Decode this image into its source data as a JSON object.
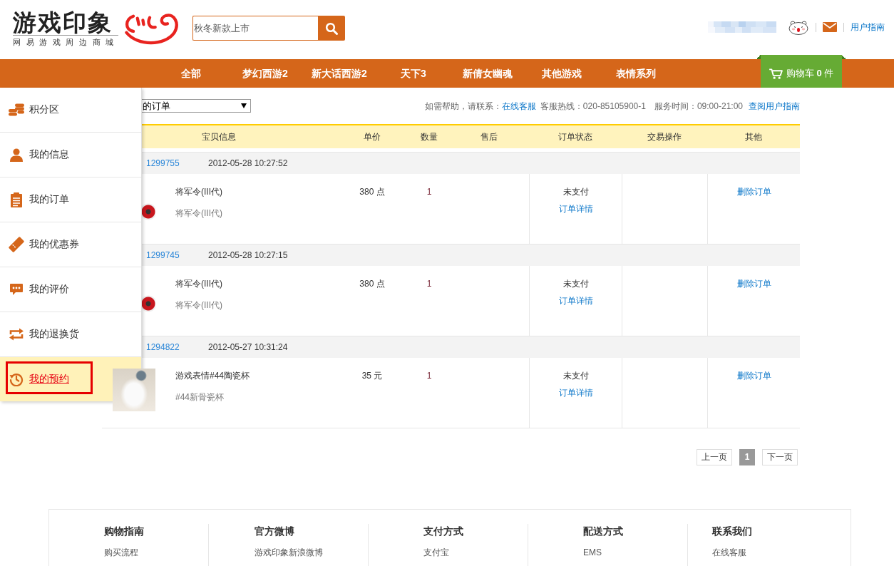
{
  "header": {
    "logo": {
      "title": "游戏印象",
      "subtitle": "网易游戏周边商城"
    },
    "search": {
      "placeholder": "秋冬新款上市"
    },
    "guide_link": "用户指南"
  },
  "nav": {
    "items": [
      "全部",
      "梦幻西游2",
      "新大话西游2",
      "天下3",
      "新倩女幽魂",
      "其他游戏",
      "表情系列"
    ],
    "cart": "购物车 **0** 件"
  },
  "sidebar": {
    "items": [
      {
        "label": "积分区",
        "selected": false,
        "highlighted": false
      },
      {
        "label": "我的信息",
        "selected": false,
        "highlighted": false
      },
      {
        "label": "我的订单",
        "selected": false,
        "highlighted": false
      },
      {
        "label": "我的优惠券",
        "selected": false,
        "highlighted": false
      },
      {
        "label": "我的评价",
        "selected": false,
        "highlighted": false
      },
      {
        "label": "我的退换货",
        "selected": false,
        "highlighted": false
      },
      {
        "label": "我的预约",
        "selected": true,
        "highlighted": true
      }
    ]
  },
  "order_filter": {
    "value": "的订单"
  },
  "help": {
    "prompt": "如需帮助，请联系：",
    "chat_link": "在线客服",
    "hotline": "客服热线：020-85105900-1",
    "hours": "服务时间：09:00-21:00",
    "guide_link": "查阅用户指南"
  },
  "table": {
    "columns": [
      "宝贝信息",
      "单价",
      "数量",
      "售后",
      "订单状态",
      "交易操作",
      "其他"
    ],
    "orders": [
      {
        "number": "1299755",
        "time": "2012-05-28 10:27:52",
        "item": {
          "name": "将军令(III代)",
          "spec": "将军令(III代)",
          "price": "380 点",
          "quantity": "1"
        },
        "status": "未支付",
        "detail_link": "订单详情",
        "action": "删除订单"
      },
      {
        "number": "1299745",
        "time": "2012-05-28 10:27:15",
        "item": {
          "name": "将军令(III代)",
          "spec": "将军令(III代)",
          "price": "380 点",
          "quantity": "1"
        },
        "status": "未支付",
        "detail_link": "订单详情",
        "action": "删除订单"
      },
      {
        "number": "1294822",
        "time": "2012-05-27 10:31:24",
        "item": {
          "name": "游戏表情#44陶瓷杯",
          "spec": "#44新骨瓷杯",
          "price": "35 元",
          "quantity": "1"
        },
        "status": "未支付",
        "detail_link": "订单详情",
        "action": "删除订单"
      }
    ]
  },
  "pagination": {
    "prev": "上一页",
    "pages": [
      {
        "label": "1",
        "selected": true
      }
    ],
    "next": "下一页"
  },
  "footer": {
    "columns": [
      {
        "title": "购物指南",
        "links": [
          "购买流程"
        ]
      },
      {
        "title": "官方微博",
        "links": [
          "游戏印象新浪微博"
        ]
      },
      {
        "title": "支付方式",
        "links": [
          "支付宝"
        ]
      },
      {
        "title": "配送方式",
        "links": [
          "EMS"
        ]
      },
      {
        "title": "联系我们",
        "links": [
          "在线客服"
        ]
      }
    ]
  }
}
